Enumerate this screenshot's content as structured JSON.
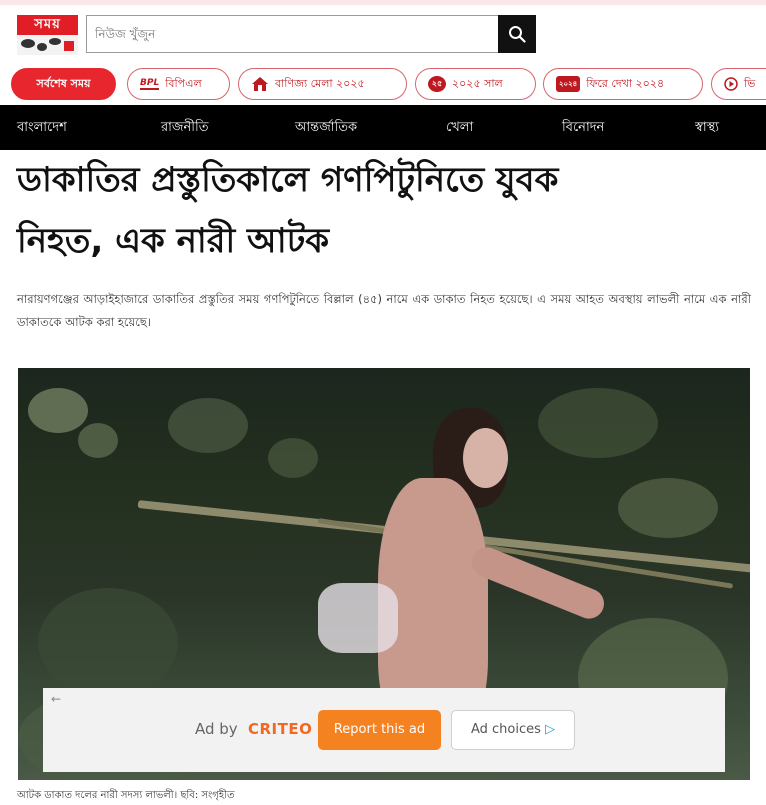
{
  "site": {
    "logo_text": "সময়",
    "search_placeholder": "নিউজ খুঁজুন"
  },
  "pills": [
    {
      "label": "সর্বশেষ সময়",
      "icon": "none",
      "active": true
    },
    {
      "label": "বিপিএল",
      "icon": "bpl-logo-icon",
      "icon_text": "BPL",
      "active": false
    },
    {
      "label": "বাণিজ্য মেলা ২০২৫",
      "icon": "fair-house-icon",
      "active": false
    },
    {
      "label": "২০২৫ সাল",
      "icon": "year-badge-icon",
      "icon_text": "২৫",
      "active": false
    },
    {
      "label": "ফিরে দেখা ২০২৪",
      "icon": "rewind-badge-icon",
      "icon_text": "২০২৪",
      "active": false
    },
    {
      "label": "ভি",
      "icon": "video-play-icon",
      "active": false
    }
  ],
  "nav": {
    "items": [
      "বাংলাদেশ",
      "রাজনীতি",
      "আন্তর্জাতিক",
      "খেলা",
      "বিনোদন",
      "স্বাস্থ্য"
    ]
  },
  "article": {
    "headline_line1": "ডাকাতির প্রস্তুতিকালে গণপিটুনিতে যুবক",
    "headline_line2": "নিহত, এক নারী আটক",
    "summary": "নারায়ণগঞ্জের আড়াইহাজারে ডাকাতির প্রস্তুতির সময় গণপিটুনিতে বিল্লাল (৪৫) নামে এক ডাকাত নিহত হয়েছে। এ সময় আহত অবস্থায় লাভলী নামে এক নারী ডাকাতকে আটক করা হয়েছে।",
    "caption": "আটক ডাকাত দলের নারী সদস্য লাভলী। ছবি: সংগৃহীত"
  },
  "ad": {
    "back_arrow": "←",
    "ad_by": "Ad by",
    "brand": "CRITEO",
    "report_label": "Report this ad",
    "choices_label": "Ad choices"
  },
  "colors": {
    "brand_red": "#e8262e",
    "nav_bg": "#000000",
    "ad_orange": "#f58220"
  }
}
